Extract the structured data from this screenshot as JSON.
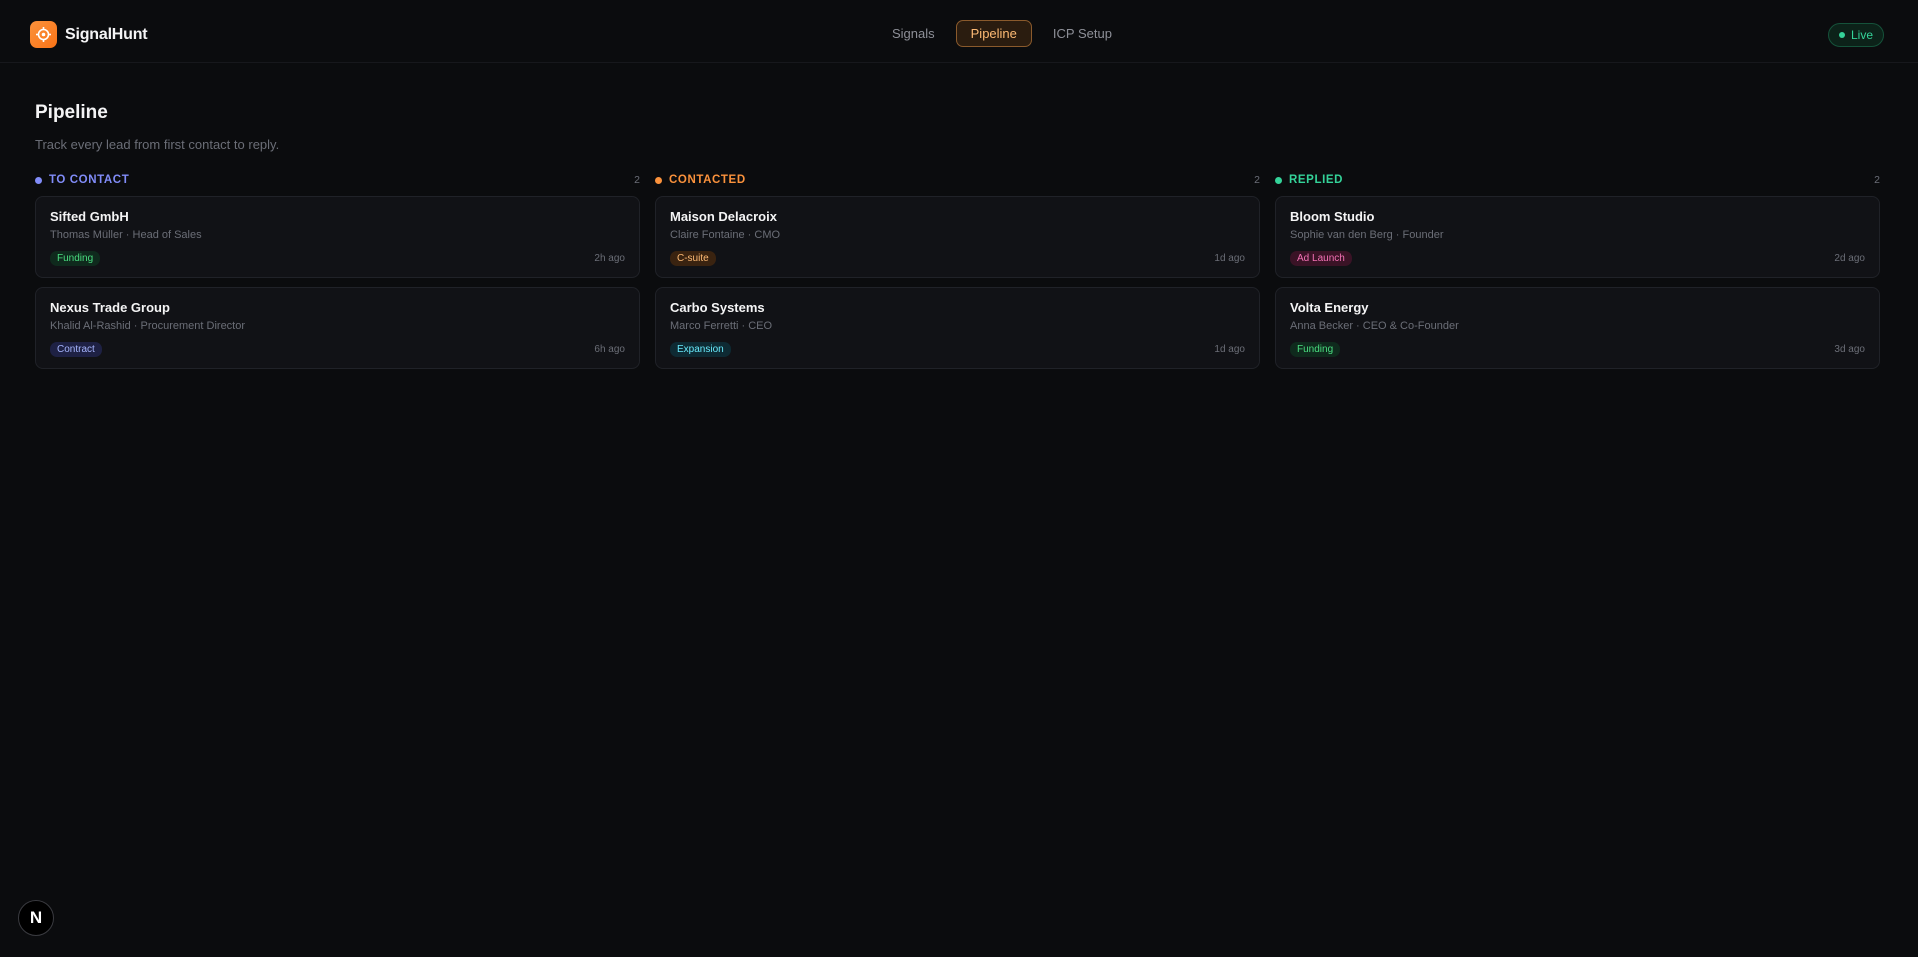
{
  "header": {
    "brand": "SignalHunt",
    "tabs": [
      {
        "label": "Signals",
        "active": false
      },
      {
        "label": "Pipeline",
        "active": true
      },
      {
        "label": "ICP Setup",
        "active": false
      }
    ],
    "status": "Live"
  },
  "page": {
    "title": "Pipeline",
    "subtitle": "Track every lead from first contact to reply."
  },
  "columns": [
    {
      "title": "TO CONTACT",
      "count": "2",
      "color": "#818cf8",
      "cards": [
        {
          "company": "Sifted GmbH",
          "person": "Thomas Müller · Head of Sales",
          "tag": "Funding",
          "time": "2h ago"
        },
        {
          "company": "Nexus Trade Group",
          "person": "Khalid Al-Rashid · Procurement Director",
          "tag": "Contract",
          "time": "6h ago"
        }
      ]
    },
    {
      "title": "CONTACTED",
      "count": "2",
      "color": "#fb923c",
      "cards": [
        {
          "company": "Maison Delacroix",
          "person": "Claire Fontaine · CMO",
          "tag": "C-suite",
          "time": "1d ago"
        },
        {
          "company": "Carbo Systems",
          "person": "Marco Ferretti · CEO",
          "tag": "Expansion",
          "time": "1d ago"
        }
      ]
    },
    {
      "title": "REPLIED",
      "count": "2",
      "color": "#34d399",
      "cards": [
        {
          "company": "Bloom Studio",
          "person": "Sophie van den Berg · Founder",
          "tag": "Ad Launch",
          "time": "2d ago"
        },
        {
          "company": "Volta Energy",
          "person": "Anna Becker · CEO & Co-Founder",
          "tag": "Funding",
          "time": "3d ago"
        }
      ]
    }
  ],
  "tag_colors": {
    "Funding": {
      "bg": "#0f2a1d",
      "fg": "#4ade80"
    },
    "Contract": {
      "bg": "#1e2144",
      "fg": "#a5b4fc"
    },
    "C-suite": {
      "bg": "#3a2310",
      "fg": "#fdba74"
    },
    "Expansion": {
      "bg": "#0e2a33",
      "fg": "#67e8f9"
    },
    "Ad Launch": {
      "bg": "#3a1326",
      "fg": "#f472b6"
    }
  },
  "footer": {
    "framework_badge": "N"
  }
}
